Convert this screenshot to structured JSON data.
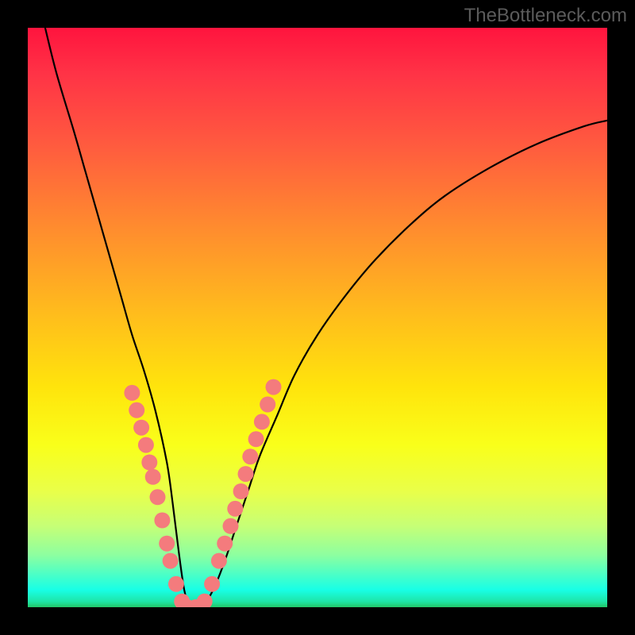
{
  "watermark": "TheBottleneck.com",
  "chart_data": {
    "type": "line",
    "title": "",
    "xlabel": "",
    "ylabel": "",
    "xlim": [
      0,
      100
    ],
    "ylim": [
      0,
      100
    ],
    "grid": false,
    "legend": false,
    "background_gradient": {
      "orientation": "vertical",
      "stops": [
        {
          "pos": 0.0,
          "color": "#ff143e"
        },
        {
          "pos": 0.5,
          "color": "#ffe40c"
        },
        {
          "pos": 0.85,
          "color": "#c6ff76"
        },
        {
          "pos": 1.0,
          "color": "#22c768"
        }
      ]
    },
    "series": [
      {
        "name": "bottleneck-curve",
        "x": [
          3,
          5,
          8,
          10,
          12,
          14,
          16,
          18,
          20,
          22,
          24,
          25,
          26,
          27,
          28,
          29,
          30,
          32,
          34,
          36,
          38,
          40,
          43,
          46,
          50,
          55,
          60,
          66,
          72,
          80,
          88,
          96,
          100
        ],
        "y": [
          100,
          92,
          82,
          75,
          68,
          61,
          54,
          47,
          41,
          34,
          25,
          18,
          10,
          3,
          0,
          0,
          0,
          3,
          8,
          14,
          20,
          26,
          33,
          40,
          47,
          54,
          60,
          66,
          71,
          76,
          80,
          83,
          84
        ]
      }
    ],
    "markers": {
      "name": "salmon-dots",
      "color": "#f47b7d",
      "radius": 10,
      "points": [
        {
          "x": 18.0,
          "y": 37.0
        },
        {
          "x": 18.8,
          "y": 34.0
        },
        {
          "x": 19.6,
          "y": 31.0
        },
        {
          "x": 20.4,
          "y": 28.0
        },
        {
          "x": 21.0,
          "y": 25.0
        },
        {
          "x": 21.6,
          "y": 22.5
        },
        {
          "x": 22.4,
          "y": 19.0
        },
        {
          "x": 23.2,
          "y": 15.0
        },
        {
          "x": 24.0,
          "y": 11.0
        },
        {
          "x": 24.6,
          "y": 8.0
        },
        {
          "x": 25.6,
          "y": 4.0
        },
        {
          "x": 26.6,
          "y": 1.0
        },
        {
          "x": 27.5,
          "y": 0.0
        },
        {
          "x": 29.0,
          "y": 0.0
        },
        {
          "x": 30.5,
          "y": 1.0
        },
        {
          "x": 31.8,
          "y": 4.0
        },
        {
          "x": 33.0,
          "y": 8.0
        },
        {
          "x": 34.0,
          "y": 11.0
        },
        {
          "x": 35.0,
          "y": 14.0
        },
        {
          "x": 35.8,
          "y": 17.0
        },
        {
          "x": 36.8,
          "y": 20.0
        },
        {
          "x": 37.6,
          "y": 23.0
        },
        {
          "x": 38.4,
          "y": 26.0
        },
        {
          "x": 39.4,
          "y": 29.0
        },
        {
          "x": 40.4,
          "y": 32.0
        },
        {
          "x": 41.4,
          "y": 35.0
        },
        {
          "x": 42.4,
          "y": 38.0
        }
      ]
    }
  }
}
